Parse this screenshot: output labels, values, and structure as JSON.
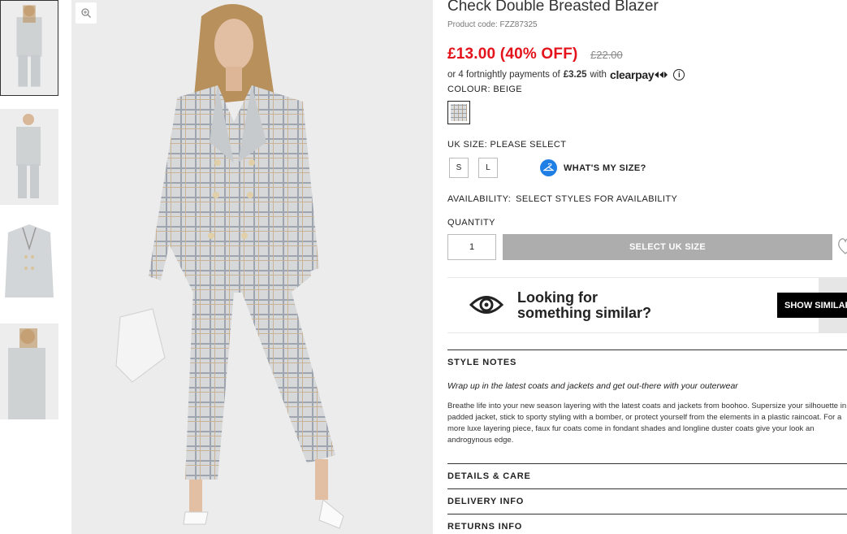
{
  "product": {
    "title": "Check Double Breasted Blazer",
    "code": "Product code: FZZ87325",
    "price_now": "£13.00 (40% OFF)",
    "price_was": "£22.00"
  },
  "clearpay": {
    "prefix": "or 4 fortnightly payments of",
    "amount": "£3.25",
    "with": "with",
    "brand": "clearpay",
    "info_icon": "info-icon"
  },
  "colour": {
    "label": "COLOUR:",
    "value": "BEIGE"
  },
  "size": {
    "label": "UK SIZE:",
    "value": "PLEASE SELECT",
    "options": [
      "S",
      "L"
    ],
    "whats_my_size": "WHAT'S MY SIZE?"
  },
  "availability": {
    "label": "AVAILABILITY:",
    "value": "SELECT STYLES FOR AVAILABILITY"
  },
  "quantity": {
    "label": "QUANTITY",
    "value": "1"
  },
  "add_button": "SELECT UK SIZE",
  "similar": {
    "line1": "Looking for",
    "line2": "something similar?",
    "button": "SHOW SIMILAR"
  },
  "style_notes": {
    "heading": "STYLE NOTES",
    "lead": "Wrap up in the latest coats and jackets and get out-there with your outerwear",
    "body": "Breathe life into your new season layering with the latest coats and jackets from boohoo. Supersize your silhouette in a padded jacket, stick to sporty styling with a bomber, or protect yourself from the elements in a plastic raincoat. For a more luxe layering piece, faux fur coats come in fondant shades and longline duster coats give your look an androgynous edge."
  },
  "accordions": [
    "DETAILS & CARE",
    "DELIVERY INFO",
    "RETURNS INFO"
  ],
  "colors": {
    "sale_red": "#e4131b",
    "button_grey": "#adadad",
    "hanger_blue": "#1f7fe5"
  }
}
